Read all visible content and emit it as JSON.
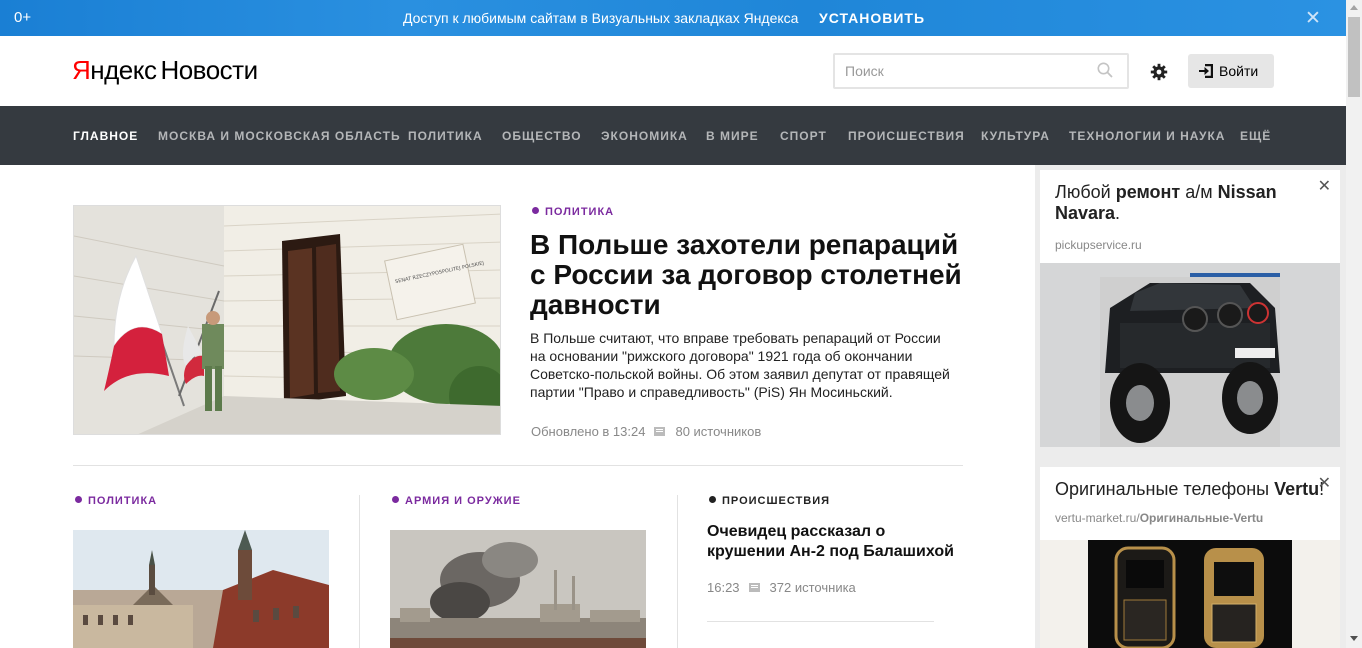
{
  "promo": {
    "age": "0+",
    "message": "Доступ к любимым сайтам в Визуальных закладках Яндекса",
    "install": "УСТАНОВИТЬ",
    "close": "✕"
  },
  "header": {
    "logo_ya": "Я",
    "logo_ndex": "ндекс",
    "logo_news": "Новости",
    "search_placeholder": "Поиск",
    "login": "Войти"
  },
  "nav": [
    {
      "label": "ГЛАВНОЕ",
      "active": true
    },
    {
      "label": "МОСКВА И МОСКОВСКАЯ ОБЛАСТЬ"
    },
    {
      "label": "ПОЛИТИКА"
    },
    {
      "label": "ОБЩЕСТВО"
    },
    {
      "label": "ЭКОНОМИКА"
    },
    {
      "label": "В МИРЕ"
    },
    {
      "label": "СПОРТ"
    },
    {
      "label": "ПРОИСШЕСТВИЯ"
    },
    {
      "label": "КУЛЬТУРА"
    },
    {
      "label": "ТЕХНОЛОГИИ И НАУКА"
    },
    {
      "label": "ЕЩЁ"
    }
  ],
  "main_story": {
    "category": "ПОЛИТИКА",
    "title": "В Польше захотели репараций с России за договор столетней давности",
    "text": "В Польше считают, что вправе требовать репараций от России на основании \"рижского договора\" 1921 года об окончании Советско-польской войны. Об этом заявил депутат от правящей партии \"Право и справедливость\" (PiS) Ян Мосиньский.",
    "updated": "Обновлено в 13:24",
    "sources": "80 источников",
    "image_alt": "Senat Rzeczypospolitej Polskiej",
    "sign_text": "SENAT RZECZYPOSPOLITEJ POLSKIEJ"
  },
  "stories": [
    {
      "category": "ПОЛИТИКА",
      "color": "#7b2a9f"
    },
    {
      "category": "АРМИЯ И ОРУЖИЕ",
      "color": "#7b2a9f"
    },
    {
      "category": "ПРОИСШЕСТВИЯ",
      "color": "#222222",
      "title": "Очевидец рассказал о крушении Ан-2 под Балашихой",
      "time": "16:23",
      "sources": "372 источника"
    }
  ],
  "ads": [
    {
      "title_parts": [
        "Любой ",
        "ремонт",
        " а/м ",
        "Nissan Navara",
        "."
      ],
      "domain": "pickupservice.ru",
      "close": "✕"
    },
    {
      "title_parts": [
        "Оригинальные телефоны ",
        "Vertu",
        "!"
      ],
      "domain_plain": "vertu-market.ru/",
      "domain_bold": "Оригинальные-Vertu",
      "close": "✕"
    }
  ],
  "colors": {
    "promo_bg": "#1f86d8",
    "nav_bg": "#353a40",
    "category": "#7b2a9f",
    "logo_red": "#ff0000"
  }
}
